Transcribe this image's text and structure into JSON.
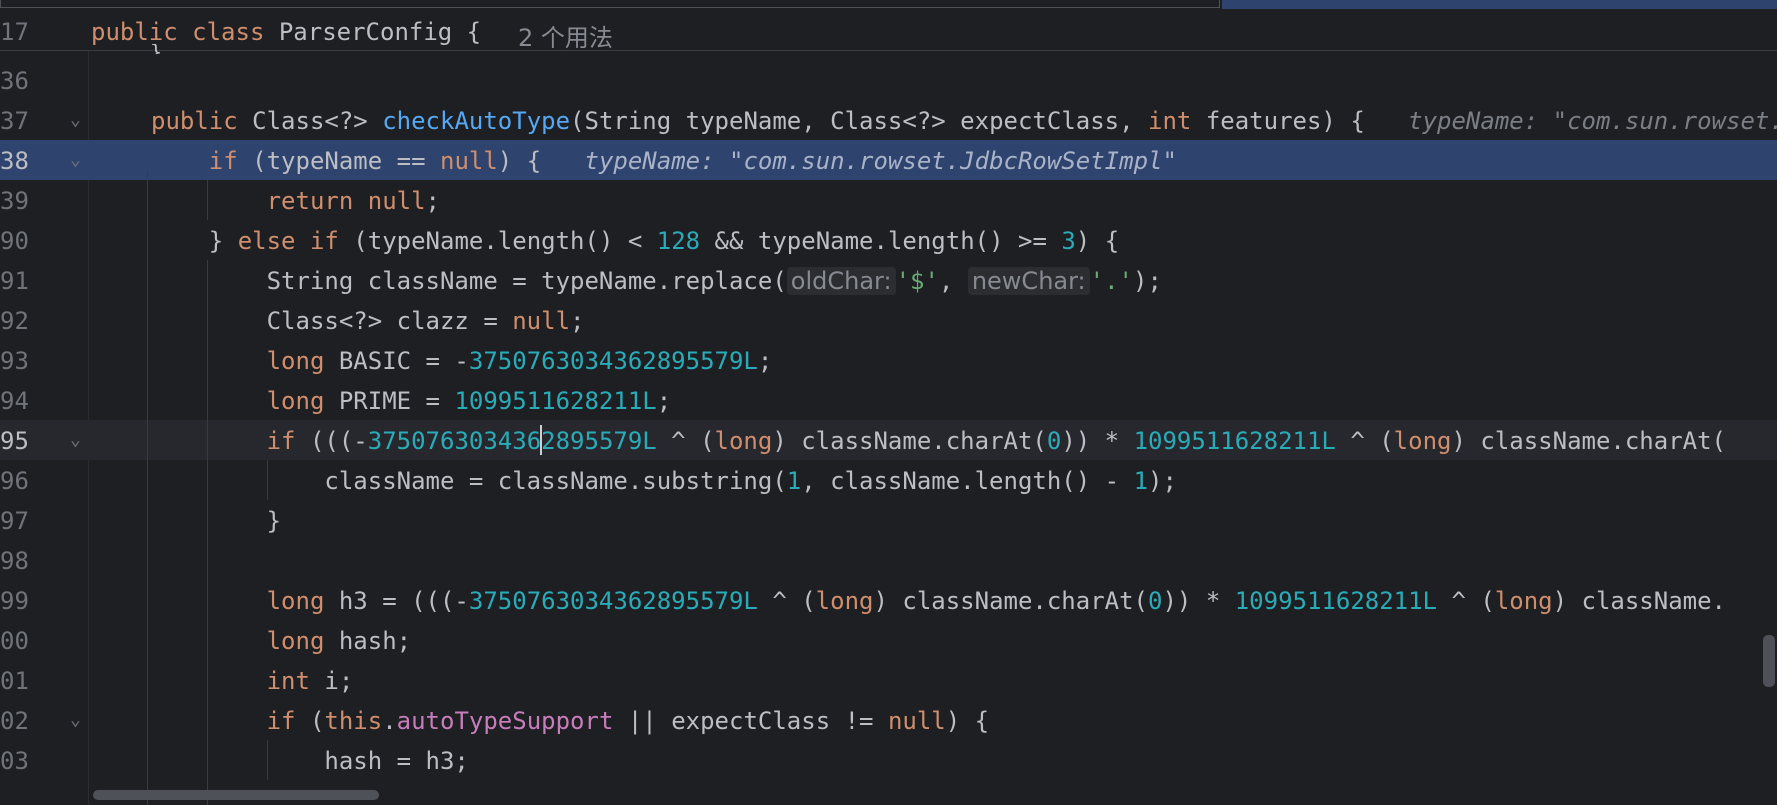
{
  "window": {
    "file": "ParserConfig"
  },
  "sticky_header": {
    "line_number": "17",
    "code": "public class ParserConfig {",
    "usages_hint": "2 个用法",
    "partial_line": "}"
  },
  "code_lines": [
    {
      "line": "36",
      "code": ""
    },
    {
      "line": "37",
      "code": "public Class<?> checkAutoType(String typeName, Class<?> expectClass, int features) {",
      "inlay_debug": "typeName: \"com.sun.rowset.JdbcRowSetImpl\""
    },
    {
      "line": "38",
      "code": "if (typeName == null) {",
      "inlay_debug": "typeName: \"com.sun.rowset.JdbcRowSetImpl\"",
      "selected": true
    },
    {
      "line": "39",
      "code": "return null;"
    },
    {
      "line": "90",
      "code": "} else if (typeName.length() < 128 && typeName.length() >= 3) {"
    },
    {
      "line": "91",
      "code": "String className = typeName.replace('$', '.');",
      "param_hints": [
        "oldChar:",
        "newChar:"
      ]
    },
    {
      "line": "92",
      "code": "Class<?> clazz = null;"
    },
    {
      "line": "93",
      "code": "long BASIC = -3750763034362895579L;"
    },
    {
      "line": "94",
      "code": "long PRIME = 1099511628211L;"
    },
    {
      "line": "95",
      "code": "if (((-3750763034362895579L ^ (long) className.charAt(0)) * 1099511628211L ^ (long) className.charAt(",
      "current": true
    },
    {
      "line": "96",
      "code": "className = className.substring(1, className.length() - 1);"
    },
    {
      "line": "97",
      "code": "}"
    },
    {
      "line": "98",
      "code": ""
    },
    {
      "line": "99",
      "code": "long h3 = (((-3750763034362895579L ^ (long) className.charAt(0)) * 1099511628211L ^ (long) className."
    },
    {
      "line": "00",
      "code": "long hash;"
    },
    {
      "line": "01",
      "code": "int i;"
    },
    {
      "line": "02",
      "code": "if (this.autoTypeSupport || expectClass != null) {"
    },
    {
      "line": "03",
      "code": "hash = h3;"
    }
  ],
  "colors": {
    "background": "#1e1f22",
    "selection": "#2e436e",
    "keyword": "#cf8e6d",
    "number": "#2aacb8",
    "method": "#56a8f5",
    "field": "#c77dbb",
    "string": "#6aab73",
    "text": "#bcbec4",
    "line_number": "#6f737a"
  }
}
